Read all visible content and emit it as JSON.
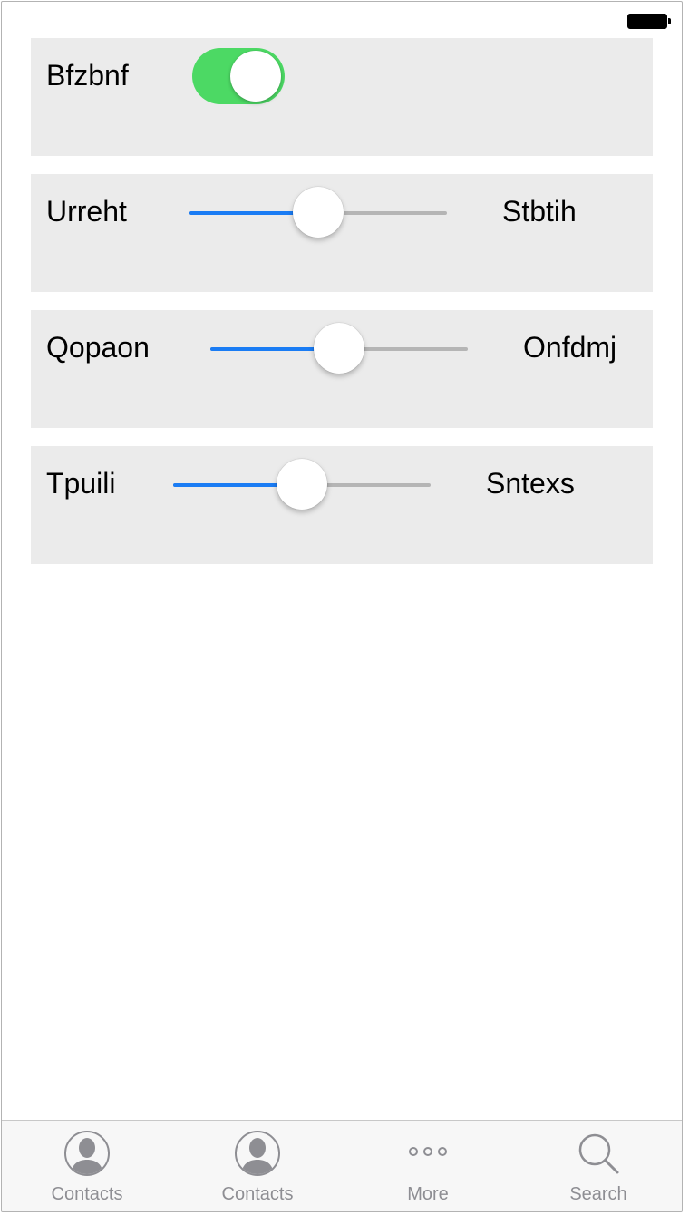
{
  "status_bar": {
    "battery_icon": "battery-full-icon"
  },
  "settings": {
    "toggle_row": {
      "label": "Bfzbnf",
      "on": true,
      "on_color": "#4cd964"
    },
    "slider_rows": [
      {
        "label": "Urreht",
        "value_label": "Stbtih",
        "value": 0.5
      },
      {
        "label": "Qopaon",
        "value_label": "Onfdmj",
        "value": 0.5
      },
      {
        "label": "Tpuili",
        "value_label": "Sntexs",
        "value": 0.5
      }
    ],
    "slider_fill_color": "#1a7cf4",
    "slider_track_color": "#b5b5b5"
  },
  "tab_bar": {
    "items": [
      {
        "label": "Contacts",
        "icon": "contact-icon"
      },
      {
        "label": "Contacts",
        "icon": "contact-icon"
      },
      {
        "label": "More",
        "icon": "more-icon"
      },
      {
        "label": "Search",
        "icon": "search-icon"
      }
    ],
    "inactive_color": "#8e8e93"
  }
}
